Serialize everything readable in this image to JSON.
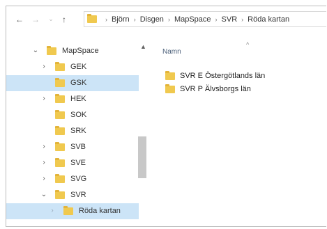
{
  "nav": {
    "back": "←",
    "forward": "→",
    "recent": "⌄",
    "up": "↑"
  },
  "breadcrumb": [
    "Björn",
    "Disgen",
    "MapSpace",
    "SVR",
    "Röda kartan"
  ],
  "breadcrumb_sep": "›",
  "tree": [
    {
      "label": "MapSpace",
      "expander": "⌄"
    },
    {
      "label": "GEK",
      "expander": "›"
    },
    {
      "label": "GSK",
      "expander": ""
    },
    {
      "label": "HEK",
      "expander": "›"
    },
    {
      "label": "SOK",
      "expander": ""
    },
    {
      "label": "SRK",
      "expander": ""
    },
    {
      "label": "SVB",
      "expander": "›"
    },
    {
      "label": "SVE",
      "expander": "›"
    },
    {
      "label": "SVG",
      "expander": "›"
    },
    {
      "label": "SVR",
      "expander": "⌄"
    },
    {
      "label": "Röda kartan",
      "expander": "›"
    }
  ],
  "scroll_up": "▲",
  "column_header": "Namn",
  "sort_indicator": "^",
  "files": [
    {
      "label": "SVR E Östergötlands län"
    },
    {
      "label": "SVR P Älvsborgs län"
    }
  ],
  "colors": {
    "folder": "#f0c94f",
    "selection": "#cce4f7"
  }
}
